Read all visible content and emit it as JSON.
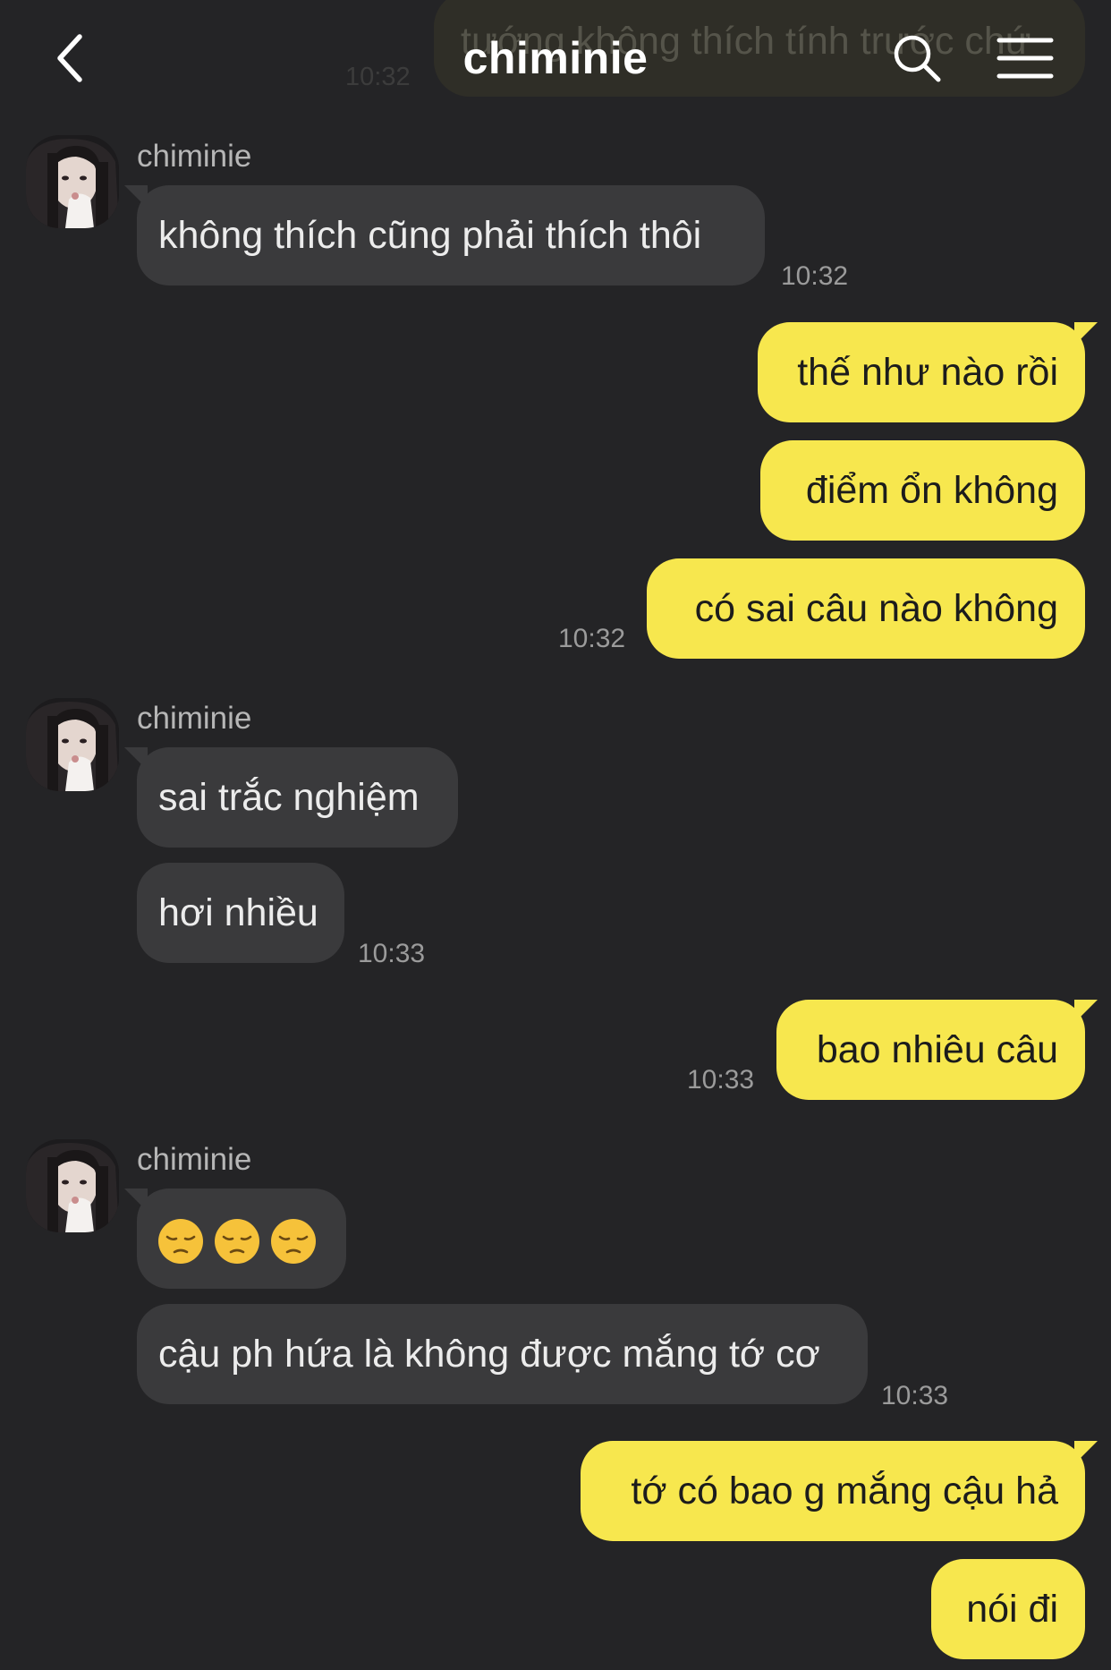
{
  "header": {
    "title": "chiminie",
    "ghost_text": "tướng không thích tính trước chứ",
    "ghost_time": "10:32"
  },
  "messages": {
    "m1": {
      "sender": "chiminie",
      "text": "không thích cũng phải thích thôi",
      "time": "10:32"
    },
    "m2": {
      "text": "thế như nào rồi"
    },
    "m3": {
      "text": "điểm ổn không"
    },
    "m4": {
      "text": "có sai câu nào không",
      "time": "10:32"
    },
    "m5": {
      "sender": "chiminie",
      "text": "sai trắc nghiệm"
    },
    "m6": {
      "text": "hơi nhiều",
      "time": "10:33"
    },
    "m7": {
      "text": "bao nhiêu câu",
      "time": "10:33"
    },
    "m8": {
      "sender": "chiminie",
      "emoji": [
        "pensive-face",
        "pensive-face",
        "pensive-face"
      ]
    },
    "m9": {
      "text": "cậu ph hứa là không được mắng tớ cơ",
      "time": "10:33"
    },
    "m10": {
      "text": "tớ có bao g mắng cậu hả"
    },
    "m11": {
      "text": "nói đi"
    }
  },
  "colors": {
    "background": "#242426",
    "incoming_bubble": "#3a3a3c",
    "outgoing_bubble": "#f7e74e",
    "timestamp": "#9b9b9b"
  },
  "icons": {
    "back": "chevron-left-icon",
    "search": "search-icon",
    "menu": "hamburger-menu-icon"
  }
}
